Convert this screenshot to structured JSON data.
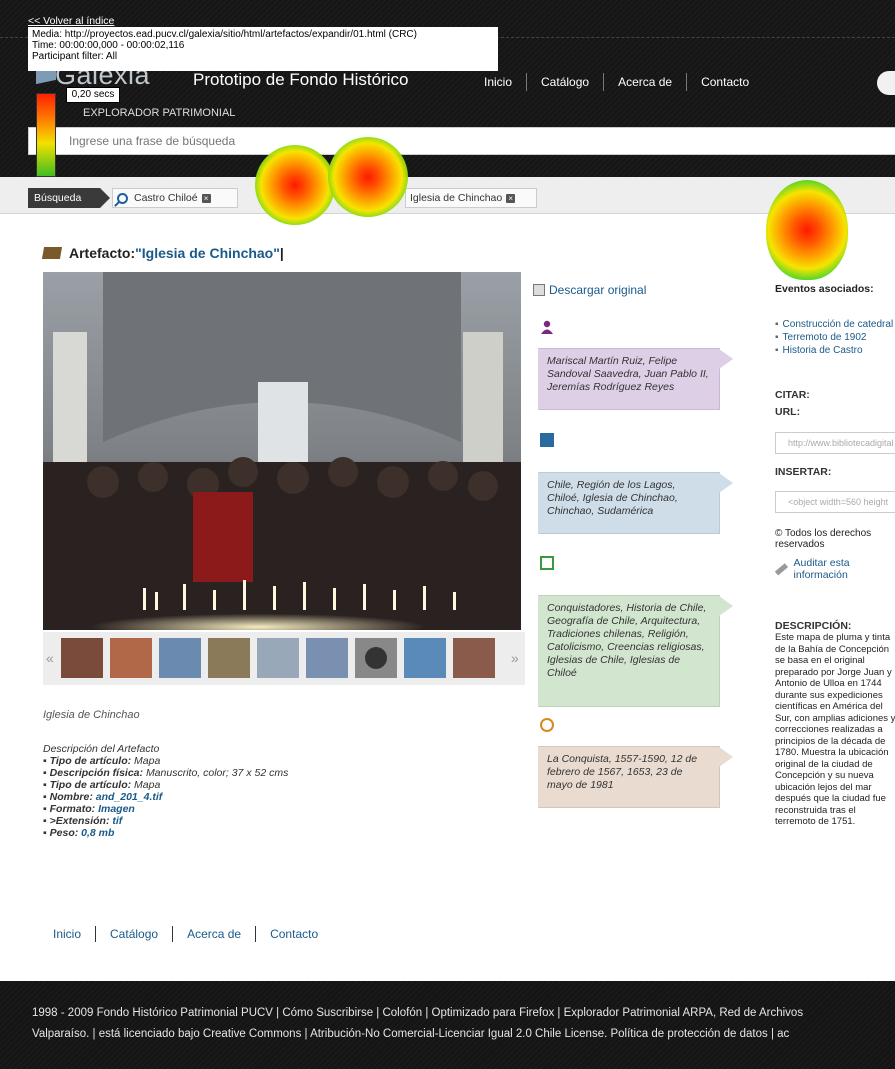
{
  "overlay": {
    "back_link": "<< Volver al índice",
    "media_line": "Media: http://proyectos.ead.pucv.cl/galexia/sitio/html/artefactos/expandir/01.html (CRC)",
    "time_line": "Time: 00:00:00,000 - 00:00:02,116",
    "filter_line": "Participant filter: All",
    "time_badge": "0,20 secs"
  },
  "header": {
    "logo_text": "Galexia",
    "site_title": "Prototipo de Fondo Histórico",
    "site_subtitle": "EXPLORADOR PATRIMONIAL",
    "nav": [
      "Inicio",
      "Catálogo",
      "Acerca de",
      "Contacto"
    ],
    "search_placeholder": "Ingrese una frase de búsqueda"
  },
  "breadcrumb": {
    "first": "Búsqueda",
    "items": [
      "Castro Chiloé",
      "Iglesia de Chinchao"
    ]
  },
  "artifact": {
    "label": "Artefacto: ",
    "name": "\"Iglesia de Chinchao\"",
    "suffix": " |"
  },
  "photo": {
    "caption": "Iglesia de Chinchao",
    "thumbnail_count": 9
  },
  "description_block": {
    "heading": "Descripción del Artefacto",
    "rows": [
      {
        "label": "Tipo de artículo:",
        "value": "Mapa"
      },
      {
        "label": "Descripción física:",
        "value": "Manuscrito, color; 37 x 52 cms"
      },
      {
        "label": "Tipo de artículo:",
        "value": "Mapa"
      },
      {
        "label": "Nombre:",
        "value": "and_201_4.tif"
      },
      {
        "label": "Formato:",
        "value": "Imagen"
      },
      {
        "label": ">Extensión:",
        "value": "tif"
      },
      {
        "label": "Peso:",
        "value": "0,8 mb"
      }
    ]
  },
  "middle": {
    "download": "Descargar original",
    "people": "Mariscal Martín Ruiz, Felipe Sandoval Saavedra, Juan Pablo II, Jeremías Rodríguez Reyes",
    "places": "Chile, Región de los Lagos, Chiloé, Iglesia de Chinchao, Chinchao, Sudamérica",
    "topics": "Conquistadores, Historia de Chile, Geografía de Chile, Arquitectura, Tradiciones chilenas, Religión, Catolicismo, Creencias religiosas, Iglesias de Chile, Iglesias de Chiloé",
    "dates": "La Conquista, 1557-1590, 12 de febrero de 1567, 1653, 23 de mayo de 1981"
  },
  "right": {
    "events_heading": "Eventos asociados:",
    "events": [
      "Construcción de catedral",
      "Terremoto de 1902",
      "Historia de Castro"
    ],
    "cite_heading": "CITAR:",
    "url_label": "URL:",
    "url_value": "http://www.bibliotecadigital",
    "embed_label": "INSERTAR:",
    "embed_value": "<object width=560 height",
    "rights": "© Todos los derechos reservados",
    "audit": "Auditar esta información",
    "desc_heading": "DESCRIPCIÓN:",
    "desc_text": "Este mapa de pluma y tinta de la Bahía de Concepción se basa en el original preparado por Jorge Juan y Antonio de Ulloa en 1744 durante sus expediciones científicas en América del Sur, con amplias adiciones y correcciones realizadas a principios de la década de 1780. Muestra la ubicación original de la ciudad de Concepción y su nueva ubicación lejos del mar después que la ciudad fue reconstruida tras el terremoto de 1751."
  },
  "bottom_nav": [
    "Inicio",
    "Catálogo",
    "Acerca de",
    "Contacto"
  ],
  "footer": {
    "line1": "1998 - 2009 Fondo Histórico Patrimonial PUCV | Cómo Suscribirse | Colofón | Optimizado para Firefox | Explorador Patrimonial ARPA, Red de Archivos",
    "line2": "Valparaíso. | está licenciado bajo Creative Commons | Atribución-No Comercial-Licenciar Igual 2.0 Chile License. Política de protección de datos | ac"
  }
}
